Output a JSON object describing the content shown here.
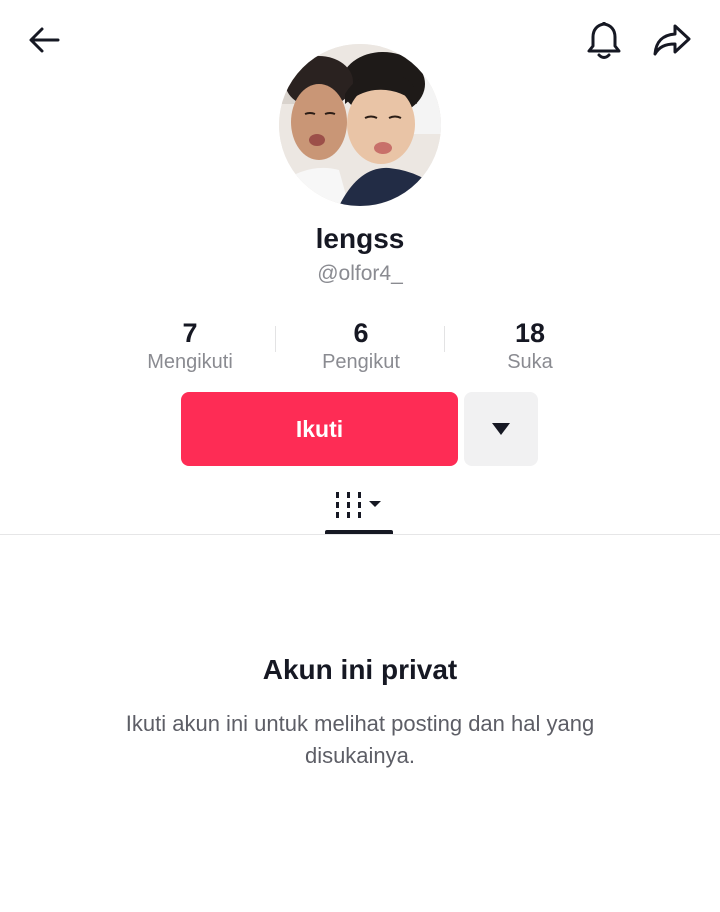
{
  "header": {
    "back_icon": "arrow-left-icon",
    "bell_icon": "bell-icon",
    "share_icon": "share-arrow-icon"
  },
  "profile": {
    "avatar": "profile-photo",
    "display_name": "lengss",
    "username": "@olfor4_"
  },
  "stats": [
    {
      "value": "7",
      "label": "Mengikuti"
    },
    {
      "value": "6",
      "label": "Pengikut"
    },
    {
      "value": "18",
      "label": "Suka"
    }
  ],
  "actions": {
    "follow_label": "Ikuti",
    "follow_color": "#fe2c55",
    "more_icon": "caret-down-icon"
  },
  "tabs": {
    "videos_icon": "grid-columns-icon"
  },
  "private_notice": {
    "title": "Akun ini privat",
    "description": "Ikuti akun ini untuk melihat posting dan hal yang disukainya."
  }
}
